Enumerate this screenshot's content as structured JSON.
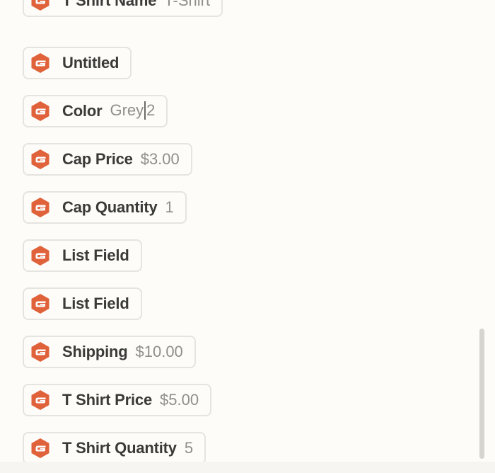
{
  "colors": {
    "icon_bg": "#e0623a",
    "label": "#3a3a38",
    "value": "#8f8e8a",
    "pill_border": "#e6e4df",
    "background": "#fdfcf9"
  },
  "fields": [
    {
      "label": "T Shirt Name",
      "value": "T-Shirt",
      "icon": "gravity-forms-icon"
    },
    {
      "label": "Untitled",
      "value": "",
      "icon": "gravity-forms-icon"
    },
    {
      "label": "Color",
      "value_before_caret": "Grey",
      "value_after_caret": "2",
      "icon": "gravity-forms-icon"
    },
    {
      "label": "Cap Price",
      "value": "$3.00",
      "icon": "gravity-forms-icon"
    },
    {
      "label": "Cap Quantity",
      "value": "1",
      "icon": "gravity-forms-icon"
    },
    {
      "label": "List Field",
      "value": "",
      "icon": "gravity-forms-icon"
    },
    {
      "label": "List Field",
      "value": "",
      "icon": "gravity-forms-icon"
    },
    {
      "label": "Shipping",
      "value": "$10.00",
      "icon": "gravity-forms-icon"
    },
    {
      "label": "T Shirt Price",
      "value": "$5.00",
      "icon": "gravity-forms-icon"
    },
    {
      "label": "T Shirt Quantity",
      "value": "5",
      "icon": "gravity-forms-icon"
    }
  ]
}
